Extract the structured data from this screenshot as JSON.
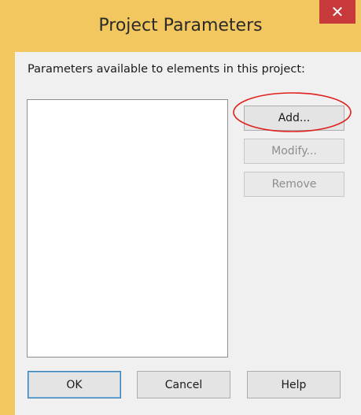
{
  "window": {
    "title": "Project Parameters",
    "close_glyph": "✕"
  },
  "dialog": {
    "prompt": "Parameters available to elements in this project:",
    "parameters": [],
    "buttons": {
      "add": "Add...",
      "modify": "Modify...",
      "remove": "Remove",
      "ok": "OK",
      "cancel": "Cancel",
      "help": "Help"
    },
    "button_states": {
      "add": "enabled",
      "modify": "disabled",
      "remove": "disabled",
      "ok": "default",
      "cancel": "enabled",
      "help": "enabled"
    }
  },
  "colors": {
    "title_bar": "#f3c75f",
    "close_button": "#c7393a",
    "highlight_annotation": "#e0201c"
  },
  "icons": {
    "close": "close-icon"
  }
}
